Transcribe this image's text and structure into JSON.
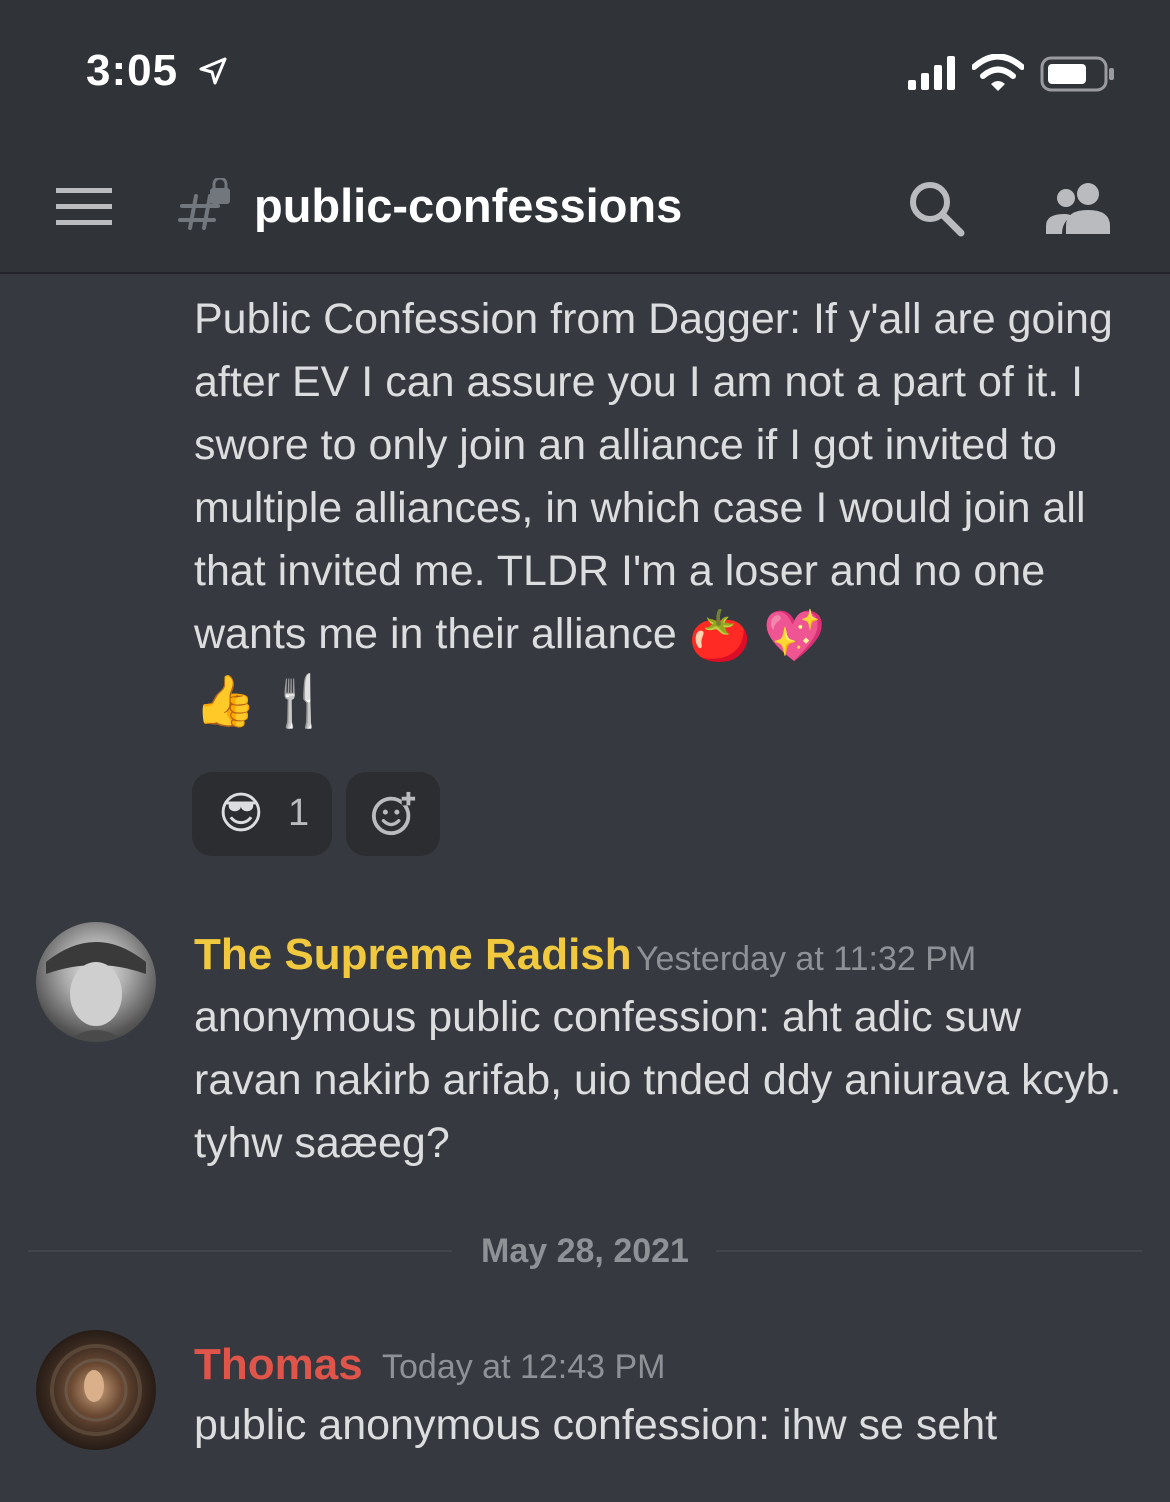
{
  "status_bar": {
    "time": "3:05"
  },
  "header": {
    "channel_name": "public-confessions"
  },
  "messages": [
    {
      "text": "Public Confession from Dagger: If y'all are going after EV I can assure you I am not a part of it. I swore to only join an alliance if I got invited to multiple alliances, in which case I would join all that invited me. TLDR I'm a loser and no one wants me in their alliance",
      "emojis": [
        "🍅",
        "💖",
        "👍",
        "🍴"
      ],
      "reactions": [
        {
          "emoji": "😎",
          "count": "1"
        }
      ]
    },
    {
      "author": "The Supreme Radish",
      "author_color": "#f0c93f",
      "timestamp": "Yesterday at 11:32 PM",
      "text": "anonymous public confession: aht adic suw ravan nakirb arifab, uio tnded ddy aniurava kcyb. tyhw saæeg?"
    },
    {
      "author": "Thomas",
      "author_color": "#e0544a",
      "timestamp": "Today at 12:43 PM",
      "text": "public anonymous confession: ihw se seht"
    }
  ],
  "date_divider": "May 28, 2021",
  "colors": {
    "background": "#36393f",
    "header": "#303338",
    "text": "#dcddde",
    "muted": "#8e9297"
  }
}
